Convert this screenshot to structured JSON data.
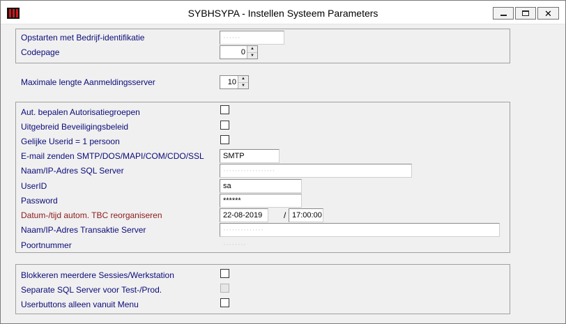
{
  "window": {
    "title": "SYBHSYPA - Instellen Systeem Parameters"
  },
  "group1": {
    "bedrijf_label": "Opstarten met Bedrijf-identifikatie",
    "bedrijf_value": "······",
    "codepage_label": "Codepage",
    "codepage_value": "0"
  },
  "group2": {
    "lengte_label": "Maximale lengte Aanmeldingsserver",
    "lengte_value": "10"
  },
  "group3": {
    "autorisatie_label": "Aut. bepalen Autorisatiegroepen",
    "beveiliging_label": "Uitgebreid Beveiligingsbeleid",
    "userid_persoon_label": "Gelijke Userid = 1 persoon",
    "email_label": "E-mail zenden SMTP/DOS/MAPI/COM/CDO/SSL",
    "email_value": "SMTP",
    "sqlserver_label": "Naam/IP-Adres SQL Server",
    "sqlserver_value": "··················",
    "userid_label": "UserID",
    "userid_value": "sa",
    "password_label": "Password",
    "password_value": "******",
    "tbc_label": "Datum-/tijd autom. TBC reorganiseren",
    "tbc_date": "22-08-2019",
    "tbc_separator": "/",
    "tbc_time": "17:00:00",
    "transaktie_label": "Naam/IP-Adres Transaktie Server",
    "transaktie_value": "··············",
    "poort_label": "Poortnummer",
    "poort_value": "········"
  },
  "group4": {
    "sessies_label": "Blokkeren meerdere Sessies/Werkstation",
    "testprod_label": "Separate SQL Server voor Test-/Prod.",
    "userbuttons_label": "Userbuttons alleen vanuit Menu"
  }
}
